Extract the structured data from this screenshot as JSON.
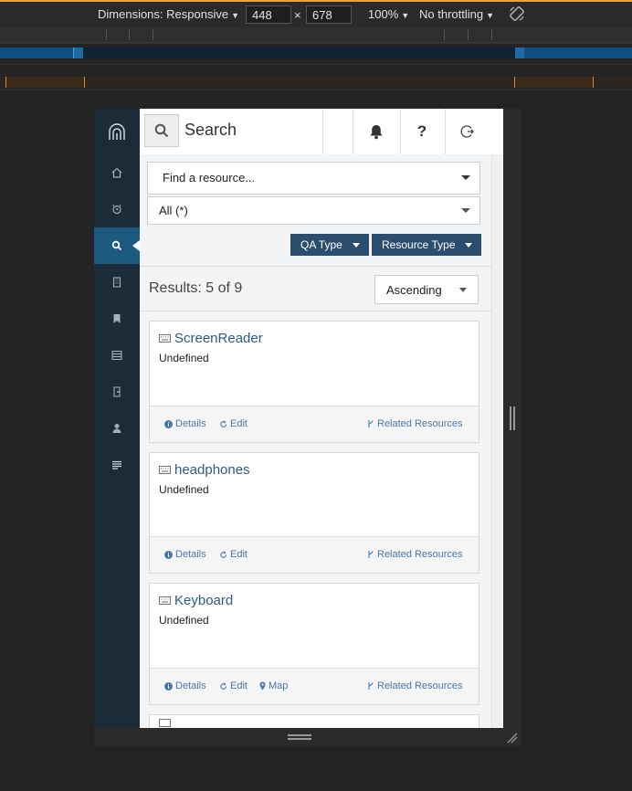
{
  "devtools": {
    "dimensions_label": "Dimensions: Responsive",
    "width_value": "448",
    "times": "×",
    "height_value": "678",
    "zoom_label": "100%",
    "throttling_label": "No throttling"
  },
  "app": {
    "search_placeholder": "Search",
    "nav_items": [
      "home-icon",
      "alarm-icon",
      "search-icon",
      "building-icon",
      "bookmark-icon",
      "server-icon",
      "door-icon",
      "user-icon",
      "list-icon"
    ],
    "find_resource_label": "Find a resource...",
    "all_filter_label": "All (*)",
    "qa_type_label": "QA Type",
    "resource_type_label": "Resource Type",
    "results_count": "Results: 5 of 9",
    "sort_label": "Ascending",
    "cards": [
      {
        "title": "ScreenReader",
        "subtitle": "Undefined",
        "details": "Details",
        "edit": "Edit",
        "related": "Related Resources"
      },
      {
        "title": "headphones",
        "subtitle": "Undefined",
        "details": "Details",
        "edit": "Edit",
        "related": "Related Resources"
      },
      {
        "title": "Keyboard",
        "subtitle": "Undefined",
        "details": "Details",
        "edit": "Edit",
        "map": "Map",
        "related": "Related Resources"
      }
    ]
  },
  "colors": {
    "sidebar": "#1c2b38",
    "active_nav": "#1d5a80",
    "button": "#2c4e6e",
    "link": "#2c5b86"
  }
}
